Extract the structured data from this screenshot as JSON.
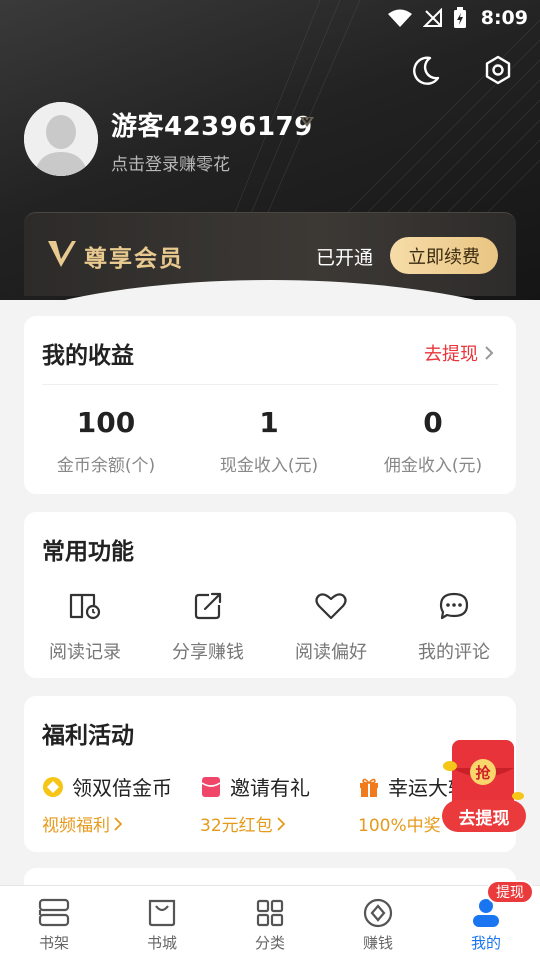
{
  "status_bar": {
    "time": "8:09"
  },
  "profile": {
    "username": "游客42396179",
    "subtitle": "点击登录赚零花"
  },
  "vip": {
    "title": "尊享会员",
    "status": "已开通",
    "renew_label": "立即续费"
  },
  "earnings": {
    "title": "我的收益",
    "withdraw_link": "去提现",
    "stats": [
      {
        "value": "100",
        "label": "金币余额(个)"
      },
      {
        "value": "1",
        "label": "现金收入(元)"
      },
      {
        "value": "0",
        "label": "佣金收入(元)"
      }
    ]
  },
  "functions": {
    "title": "常用功能",
    "items": [
      {
        "label": "阅读记录",
        "icon": "reading-record-icon"
      },
      {
        "label": "分享赚钱",
        "icon": "share-icon"
      },
      {
        "label": "阅读偏好",
        "icon": "heart-icon"
      },
      {
        "label": "我的评论",
        "icon": "comment-icon"
      }
    ]
  },
  "welfare": {
    "title": "福利活动",
    "items": [
      {
        "title": "领双倍金币",
        "sub": "视频福利",
        "icon": "coin-icon",
        "color": "#f5c518"
      },
      {
        "title": "邀请有礼",
        "sub": "32元红包",
        "icon": "red-envelope-icon",
        "color": "#f0466a"
      },
      {
        "title": "幸运大转",
        "sub": "100%中奖",
        "icon": "gift-icon",
        "color": "#f07a1c"
      }
    ]
  },
  "floating": {
    "redpack_char": "抢",
    "button_label": "去提现"
  },
  "tabbar": {
    "badge": "提现",
    "tabs": [
      {
        "label": "书架",
        "icon": "bookshelf-icon"
      },
      {
        "label": "书城",
        "icon": "bookstore-icon"
      },
      {
        "label": "分类",
        "icon": "category-icon"
      },
      {
        "label": "赚钱",
        "icon": "earn-icon"
      },
      {
        "label": "我的",
        "icon": "profile-icon"
      }
    ]
  },
  "colors": {
    "accent_red": "#e8343a",
    "active_blue": "#1976f0",
    "vip_gold": "#e8c98f"
  }
}
